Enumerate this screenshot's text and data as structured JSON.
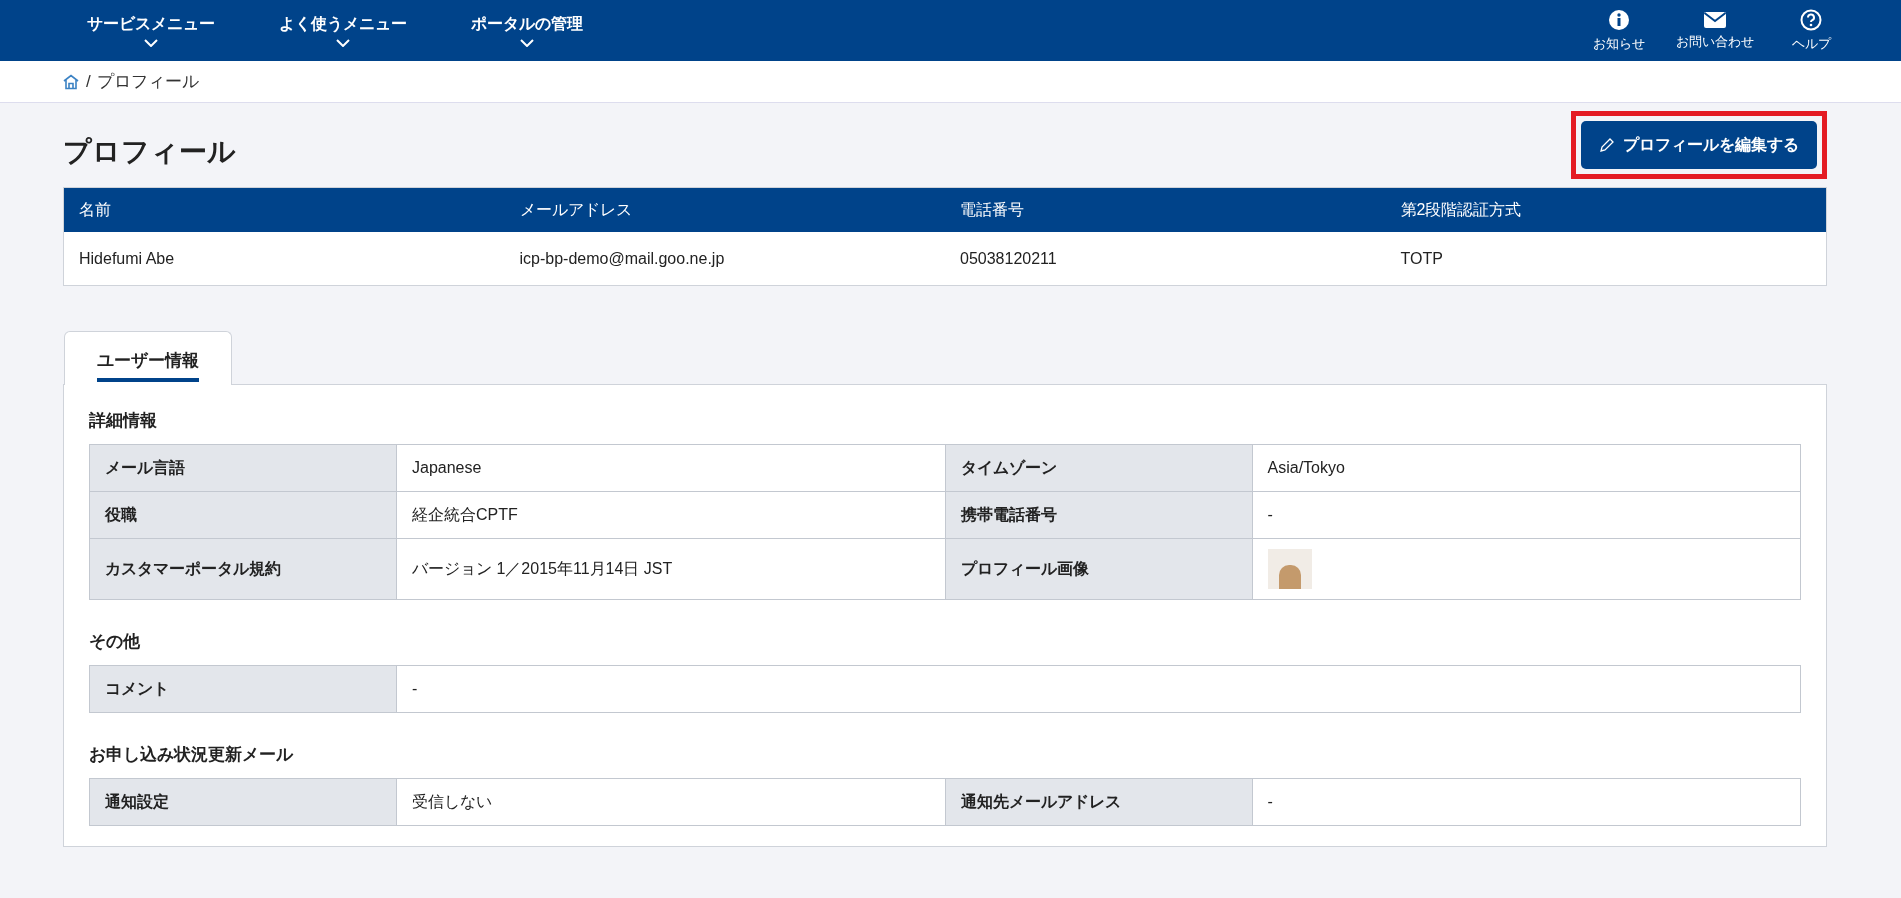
{
  "nav": {
    "menus": [
      {
        "label": "サービスメニュー"
      },
      {
        "label": "よく使うメニュー"
      },
      {
        "label": "ポータルの管理"
      }
    ],
    "utilities": [
      {
        "kind": "info",
        "label": "お知らせ"
      },
      {
        "kind": "mail",
        "label": "お問い合わせ"
      },
      {
        "kind": "help",
        "label": "ヘルプ"
      }
    ]
  },
  "breadcrumb": {
    "separator": "/",
    "current": "プロフィール"
  },
  "page_title": "プロフィール",
  "edit_button": {
    "label": "プロフィールを編集する",
    "highlighted": true
  },
  "summary": {
    "columns": [
      "名前",
      "メールアドレス",
      "電話番号",
      "第2段階認証方式"
    ],
    "row": [
      "Hidefumi Abe",
      "icp-bp-demo@mail.goo.ne.jp",
      "05038120211",
      "TOTP"
    ]
  },
  "tabs": [
    {
      "label": "ユーザー情報",
      "selected": true
    }
  ],
  "sections": [
    {
      "title": "詳細情報",
      "rows": [
        [
          {
            "label": "メール言語",
            "kind": "text",
            "value": "Japanese"
          },
          {
            "label": "タイムゾーン",
            "kind": "text",
            "value": "Asia/Tokyo"
          }
        ],
        [
          {
            "label": "役職",
            "kind": "text",
            "value": "経企統合CPTF"
          },
          {
            "label": "携帯電話番号",
            "kind": "text",
            "value": "-"
          }
        ],
        [
          {
            "label": "カスタマーポータル規約",
            "kind": "text",
            "value": "バージョン 1／2015年11月14日 JST"
          },
          {
            "label": "プロフィール画像",
            "kind": "image"
          }
        ]
      ]
    },
    {
      "title": "その他",
      "rows": [
        [
          {
            "label": "コメント",
            "kind": "text",
            "value": "-"
          }
        ]
      ]
    },
    {
      "title": "お申し込み状況更新メール",
      "rows": [
        [
          {
            "label": "通知設定",
            "kind": "text",
            "value": "受信しない"
          },
          {
            "label": "通知先メールアドレス",
            "kind": "text",
            "value": "-"
          }
        ]
      ]
    }
  ]
}
